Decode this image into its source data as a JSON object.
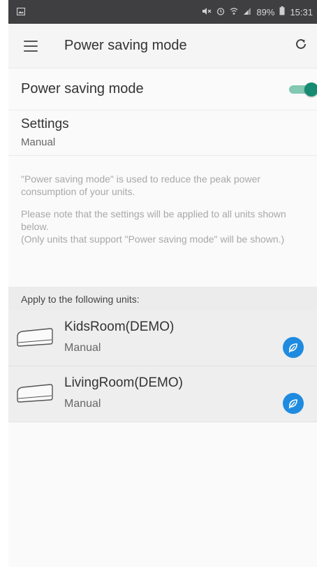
{
  "status_bar": {
    "battery_percent": "89%",
    "time": "15:31",
    "icons": [
      "image-icon",
      "mute-icon",
      "alarm-icon",
      "wifi-icon",
      "signal-icon",
      "battery-icon"
    ]
  },
  "app_bar": {
    "title": "Power saving mode",
    "icons": [
      "menu-icon",
      "refresh-icon"
    ]
  },
  "power_saving": {
    "label": "Power saving mode",
    "enabled": true,
    "toggle_color": "#168a72"
  },
  "settings": {
    "title": "Settings",
    "value": "Manual"
  },
  "description": {
    "paragraph1": "\"Power saving mode\" is used to reduce the peak power consumption of your units.",
    "paragraph2": "Please note that the settings will be applied to all units shown below.",
    "paragraph3": "(Only units that support \"Power saving mode\" will be shown.)"
  },
  "units_section": {
    "header": "Apply to the following units:",
    "units": [
      {
        "name": "KidsRoom(DEMO)",
        "mode": "Manual",
        "icon": "leaf-icon",
        "badge_color": "#1f8be0"
      },
      {
        "name": "LivingRoom(DEMO)",
        "mode": "Manual",
        "icon": "leaf-icon",
        "badge_color": "#1f8be0"
      }
    ]
  }
}
